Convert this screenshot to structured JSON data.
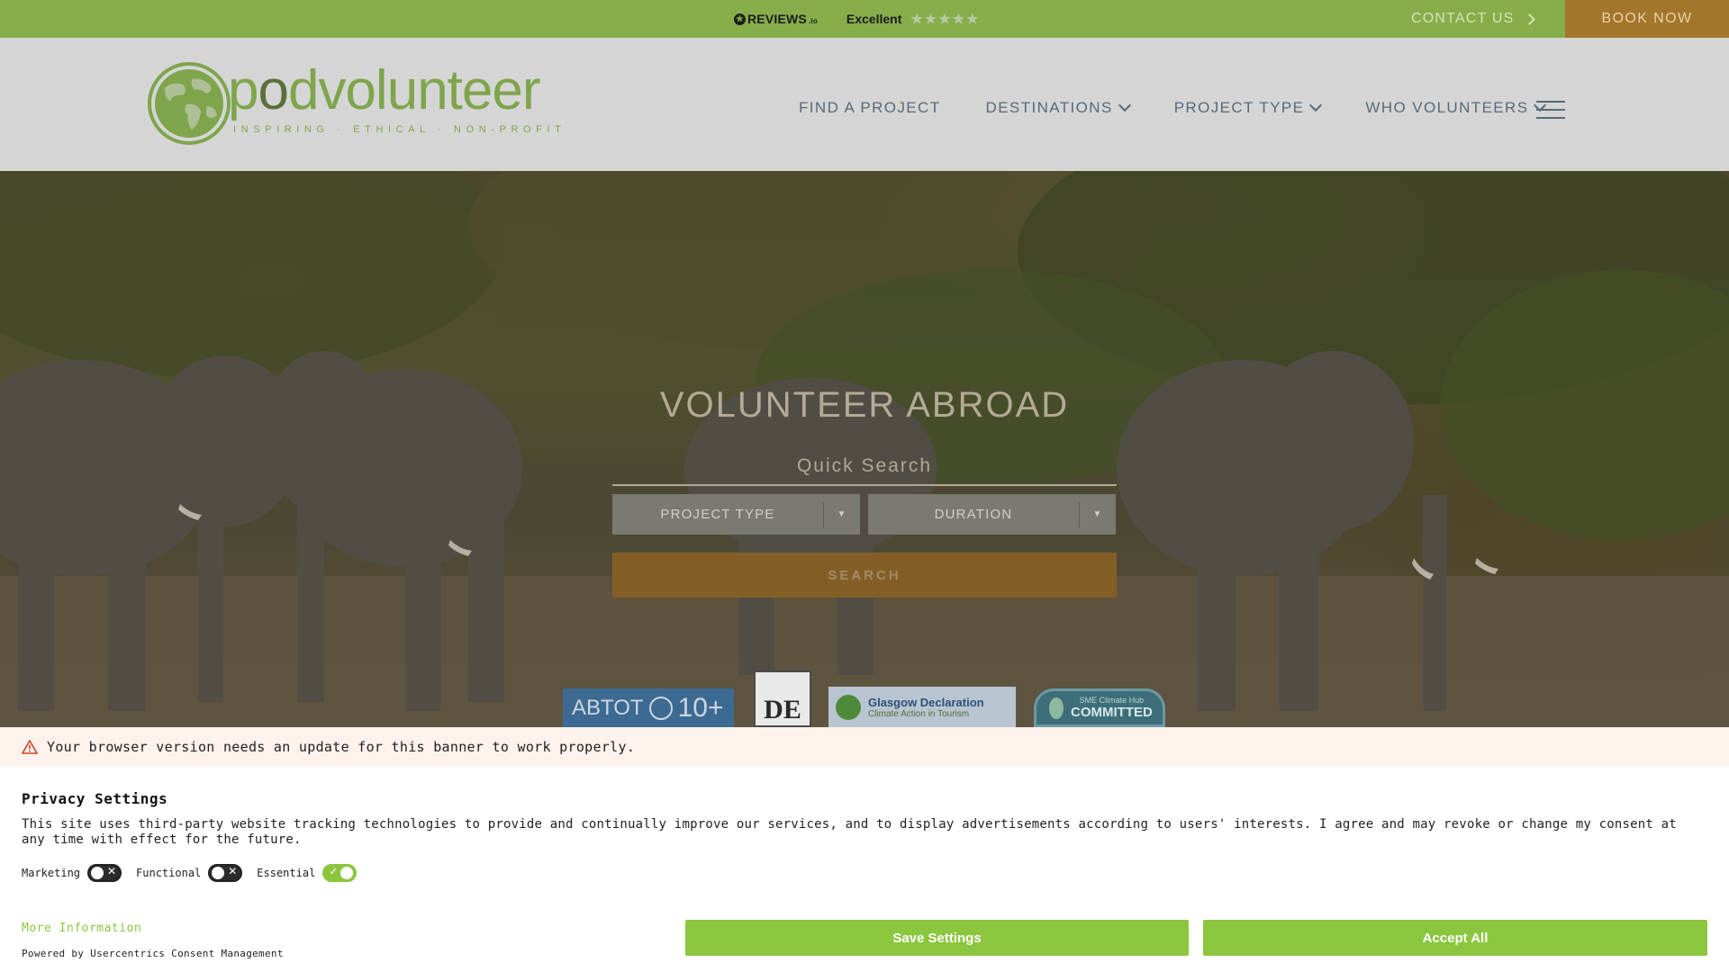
{
  "topbar": {
    "reviews_brand": "REVIEWS",
    "reviews_suffix": ".io",
    "rating_label": "Excellent",
    "stars": "★★★★★",
    "contact_label": "CONTACT US",
    "book_label": "BOOK NOW"
  },
  "header": {
    "logo_text_a": "p",
    "logo_text_b": "o",
    "logo_text_c": "d",
    "logo_text_d": "volunteer",
    "logo_tagline": "INSPIRING · ETHICAL · NON-PROFIT",
    "nav": [
      {
        "label": "FIND A PROJECT"
      },
      {
        "label": "DESTINATIONS"
      },
      {
        "label": "PROJECT TYPE"
      },
      {
        "label": "WHO VOLUNTEERS"
      }
    ]
  },
  "hero": {
    "title": "VOLUNTEER ABROAD",
    "quick_search": "Quick Search",
    "project_type": "PROJECT TYPE",
    "duration": "DURATION",
    "search_label": "SEARCH",
    "certs": {
      "abtot": "ABTOT",
      "abtot_years": "10+",
      "glasgow_title": "Glasgow Declaration",
      "glasgow_sub": "Climate Action in Tourism",
      "sme_title": "SME Climate Hub",
      "sme_sub": "COMMITTED"
    }
  },
  "consent": {
    "warning": "Your browser version needs an update for this banner to work properly.",
    "title": "Privacy Settings",
    "text": "This site uses third-party website tracking technologies to provide and continually improve our services, and to display advertisements according to users' interests. I agree and may revoke or change my consent at any time with effect for the future.",
    "toggles": [
      {
        "label": "Marketing",
        "state": "off"
      },
      {
        "label": "Functional",
        "state": "off"
      },
      {
        "label": "Essential",
        "state": "on"
      }
    ],
    "more_info": "More Information",
    "powered_by": "Powered by Usercentrics Consent Management",
    "save_label": "Save Settings",
    "accept_label": "Accept All"
  },
  "colors": {
    "topbar_green": "#87ad4b",
    "book_orange": "#a3762b",
    "consent_green": "#8cc63e",
    "nav_text": "#566a7a"
  }
}
